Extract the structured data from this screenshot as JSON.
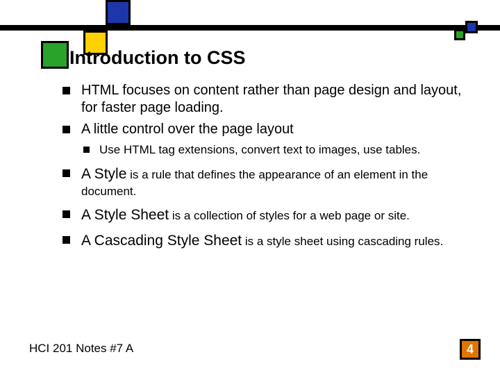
{
  "title": "Introduction to CSS",
  "bullets": {
    "b1": "HTML focuses on content rather than page design and layout, for faster page loading.",
    "b2": "A little control over the page layout",
    "b2a": "Use HTML tag extensions, convert text to images, use tables.",
    "b3_lead": "A Style",
    "b3_rest": " is a rule that defines the appearance of an element in the document.",
    "b4_lead": "A Style Sheet",
    "b4_rest": " is a collection of styles for a web page or site.",
    "b5_lead": "A Cascading Style Sheet",
    "b5_rest": " is a style sheet using cascading rules."
  },
  "footer": "HCI 201 Notes #7 A",
  "page": "4"
}
